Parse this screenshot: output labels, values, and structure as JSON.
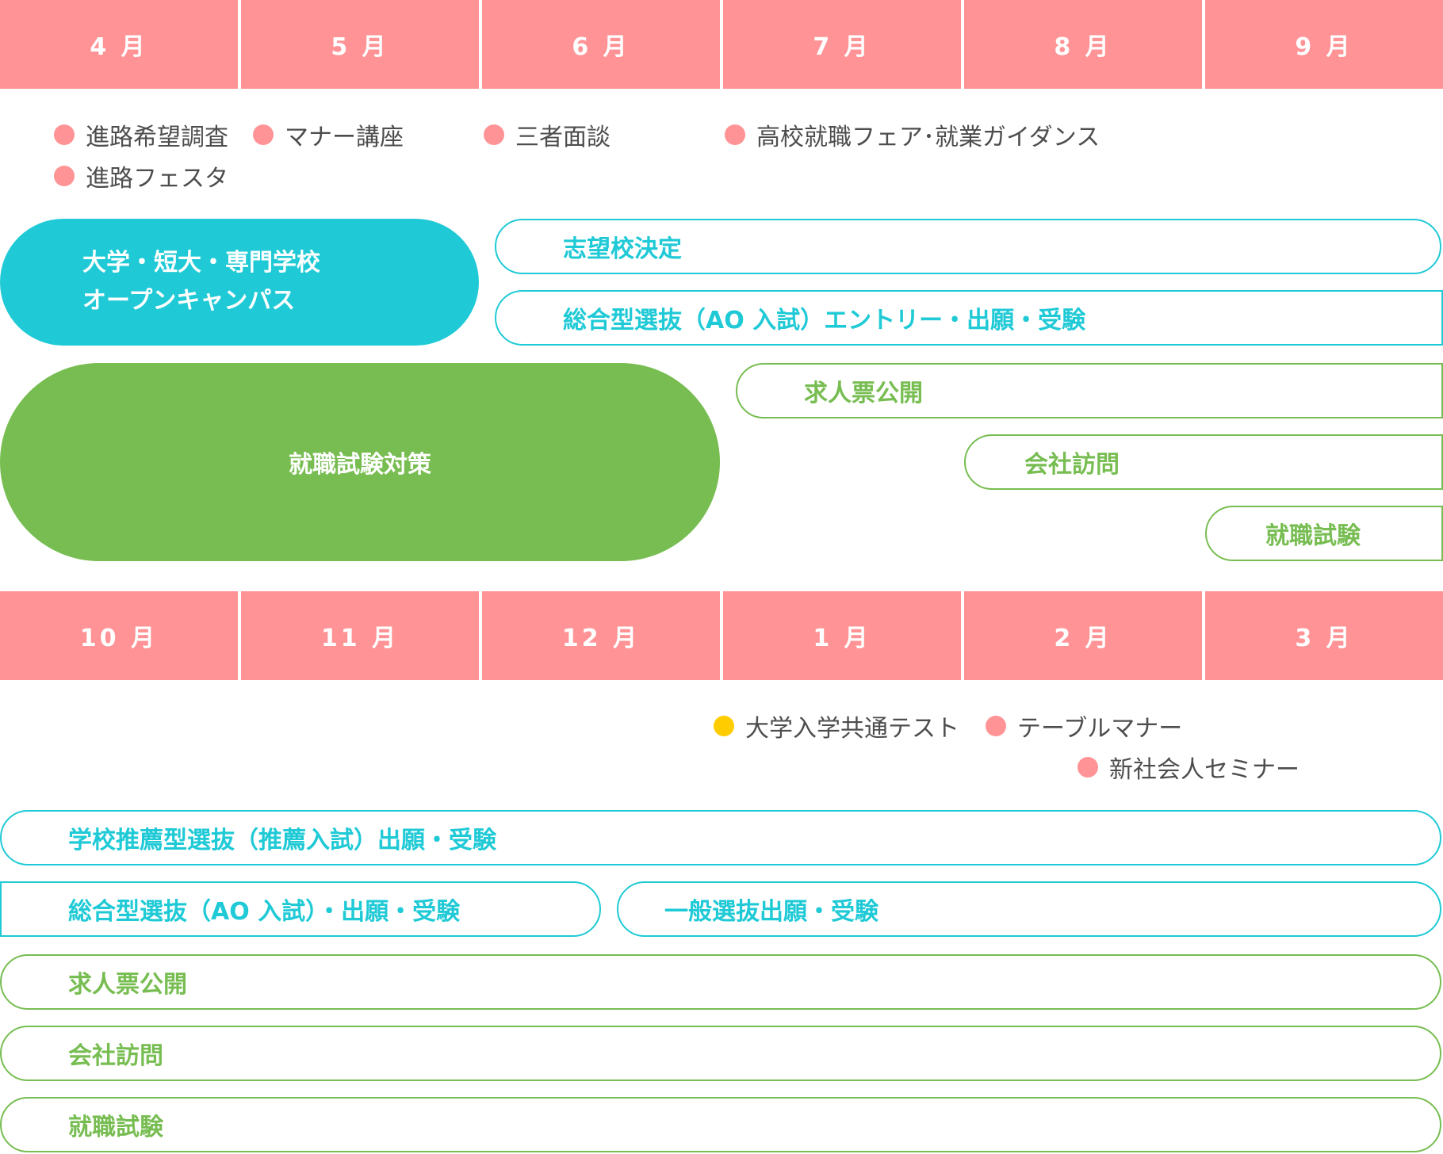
{
  "months_top": [
    "4 月",
    "5 月",
    "6 月",
    "7 月",
    "8 月",
    "9 月"
  ],
  "months_bottom": [
    "10 月",
    "11 月",
    "12 月",
    "1 月",
    "2 月",
    "3 月"
  ],
  "events_top": {
    "e1": "進路希望調査",
    "e2": "マナー講座",
    "e3": "三者面談",
    "e4": "高校就職フェア･就業ガイダンス",
    "e5": "進路フェスタ"
  },
  "events_bottom": {
    "e1": "大学入学共通テスト",
    "e2": "テーブルマナー",
    "e3": "新社会人セミナー"
  },
  "bars_top": {
    "campus_line1": "大学・短大・専門学校",
    "campus_line2": "オープンキャンパス",
    "shibou": "志望校決定",
    "ao_entry": "総合型選抜（AO 入試）エントリー・出願・受験",
    "job_prep": "就職試験対策",
    "kyujin": "求人票公開",
    "kaisha": "会社訪問",
    "shiken": "就職試験"
  },
  "bars_bottom": {
    "suisen": "学校推薦型選抜（推薦入試）出願・受験",
    "ao": "総合型選抜（AO 入試）・出願・受験",
    "ippan": "一般選抜出願・受験",
    "kyujin": "求人票公開",
    "kaisha": "会社訪問",
    "shiken": "就職試験"
  },
  "colors": {
    "month_bg": "#ff9396",
    "blue": "#1fcad6",
    "green": "#77bd51",
    "dot_pink": "#ff9396",
    "dot_yellow": "#ffcc00"
  }
}
